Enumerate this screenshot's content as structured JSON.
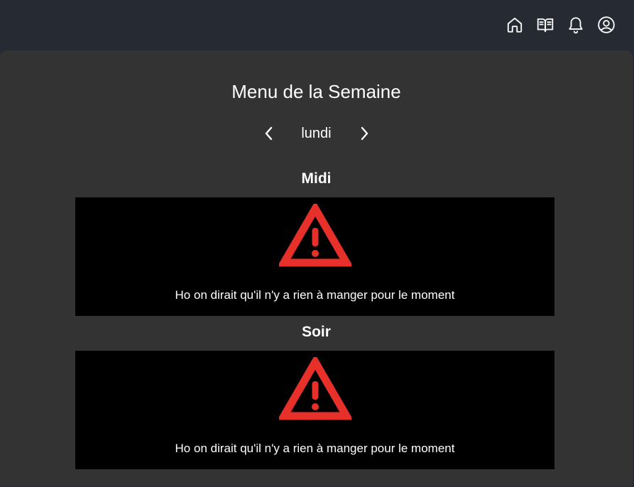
{
  "header": {
    "icons": [
      "home-icon",
      "book-icon",
      "bell-icon",
      "user-circle-icon"
    ]
  },
  "page": {
    "title": "Menu de la Semaine",
    "day": "lundi"
  },
  "meals": [
    {
      "title": "Midi",
      "empty_message": "Ho on dirait qu'il n'y a rien à manger pour le moment"
    },
    {
      "title": "Soir",
      "empty_message": "Ho on dirait qu'il n'y a rien à manger pour le moment"
    }
  ],
  "colors": {
    "background": "#262a33",
    "panel": "#333333",
    "box": "#000000",
    "warning": "#e8302a"
  }
}
